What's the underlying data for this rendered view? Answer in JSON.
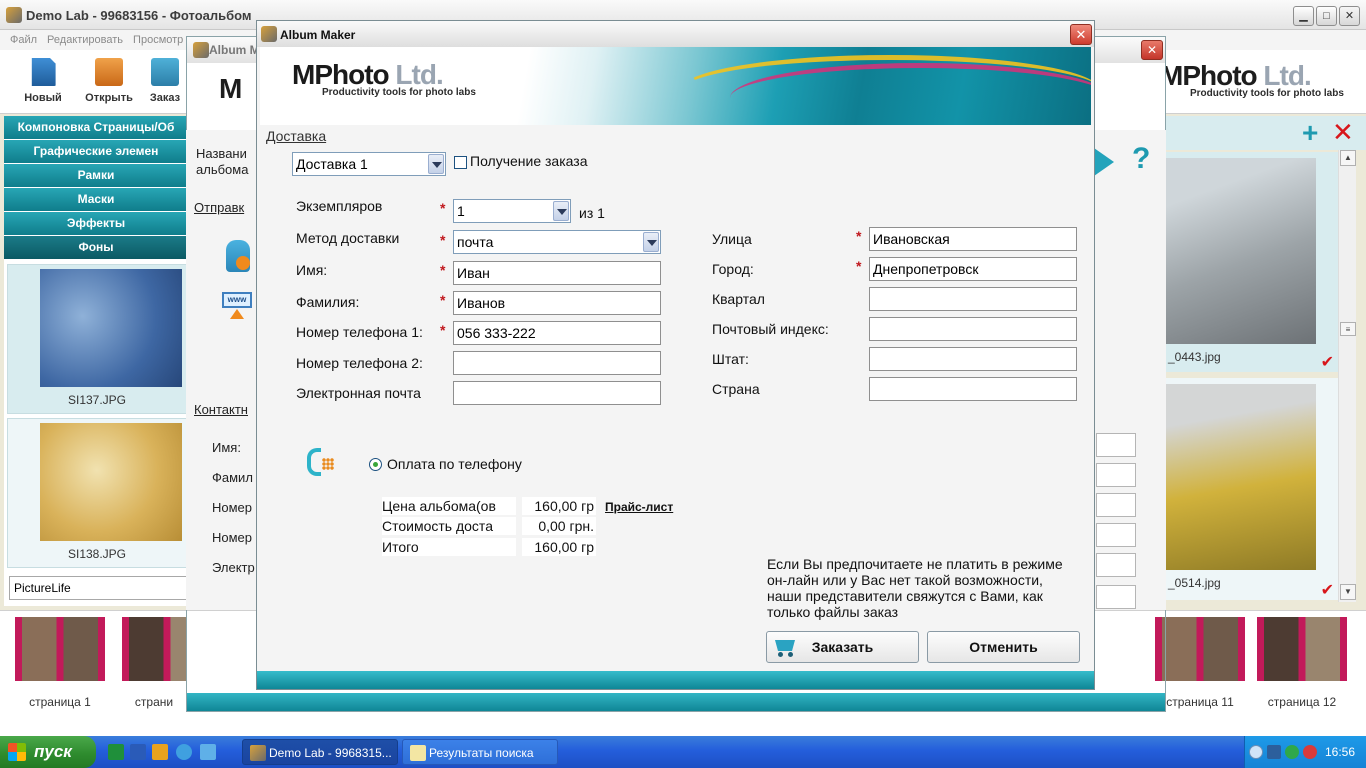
{
  "main_window": {
    "title": "Demo Lab - 99683156 - Фотоальбом",
    "menu": [
      "Файл",
      "Редактировать",
      "Просмотр"
    ],
    "toolbar": {
      "new": "Новый",
      "open": "Открыть",
      "order": "Заказ"
    },
    "logo": {
      "name": "MPhoto",
      "suffix": "Ltd.",
      "tagline": "Productivity tools for photo labs"
    }
  },
  "left_panel": {
    "sections": [
      "Компоновка Страницы/Об",
      "Графические элемен",
      "Рамки",
      "Маски",
      "Эффекты",
      "Фоны"
    ],
    "thumbnails": [
      {
        "caption": "SI137.JPG"
      },
      {
        "caption": "SI138.JPG"
      }
    ],
    "category_select": "PictureLife"
  },
  "right_panel": {
    "photos": [
      {
        "caption": "_0443.jpg"
      },
      {
        "caption": "_0514.jpg"
      }
    ]
  },
  "back_dialog": {
    "title": "Album M",
    "fragments": {
      "name_label": "Названи",
      "name_label2": "альбома",
      "send_link": "Отправк",
      "contact_link": "Контактн",
      "first_name": "Имя:",
      "last_name": "Фамил",
      "phone1": "Номер",
      "phone2": "Номер",
      "email": "Электр"
    }
  },
  "dialog": {
    "title": "Album Maker",
    "logo": {
      "name": "MPhoto",
      "suffix": "Ltd.",
      "tagline": "Productivity tools for photo labs"
    },
    "delivery_link": "Доставка",
    "delivery_select": "Доставка 1",
    "pickup_label": "Получение заказа",
    "fields": {
      "copies": {
        "label": "Экземпляров",
        "value": "1",
        "of_text": "из 1"
      },
      "method": {
        "label": "Метод доставки",
        "value": "почта"
      },
      "first_name": {
        "label": "Имя:",
        "value": "Иван"
      },
      "last_name": {
        "label": "Фамилия:",
        "value": "Иванов"
      },
      "phone1": {
        "label": "Номер телефона 1:",
        "value": "056 333-222"
      },
      "phone2": {
        "label": "Номер телефона 2:",
        "value": ""
      },
      "email": {
        "label": "Электронная почта",
        "value": ""
      },
      "street": {
        "label": "Улица",
        "value": "Ивановская"
      },
      "city": {
        "label": "Город:",
        "value": "Днепропетровск"
      },
      "district": {
        "label": "Квартал",
        "value": ""
      },
      "postal": {
        "label": "Почтовый индекс:",
        "value": ""
      },
      "state": {
        "label": "Штат:",
        "value": ""
      },
      "country": {
        "label": "Страна",
        "value": ""
      }
    },
    "payment_option": "Оплата по телефону",
    "prices": [
      {
        "label": "Цена  альбома(ов",
        "value": "160,00 гр"
      },
      {
        "label": "Стоимость доста",
        "value": "0,00 грн."
      },
      {
        "label": "Итого",
        "value": "160,00 гр"
      }
    ],
    "price_list_link": "Прайс-лист",
    "note": "Если Вы предпочитаете не платить в режиме он-лайн или у Вас нет такой возможности, наши представители свяжутся с  Вами, как только файлы заказ",
    "order_button": "Заказать",
    "cancel_button": "Отменить"
  },
  "page_strip": [
    {
      "label": "страница 1"
    },
    {
      "label": "страни"
    },
    {
      "label": "страница 11"
    },
    {
      "label": "страница 12"
    }
  ],
  "taskbar": {
    "start": "пуск",
    "tasks": [
      {
        "label": "Demo Lab - 9968315..."
      },
      {
        "label": "Результаты поиска"
      }
    ],
    "clock": "16:56"
  }
}
